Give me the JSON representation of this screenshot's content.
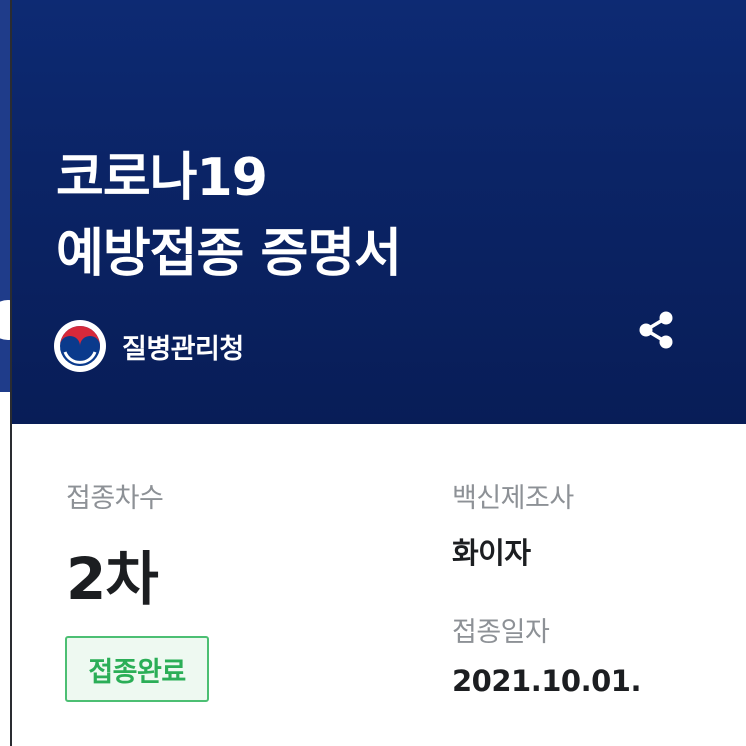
{
  "header": {
    "title_line1": "코로나19",
    "title_line2": "예방접종 증명서",
    "agency_name": "질병관리청",
    "share_icon": "share-icon",
    "agency_emblem": "taegeuk-emblem-icon"
  },
  "vaccination": {
    "dose_label": "접종차수",
    "dose_value": "2차",
    "status_badge": "접종완료",
    "manufacturer_label": "백신제조사",
    "manufacturer_value": "화이자",
    "date_label": "접종일자",
    "date_value": "2021.10.01."
  },
  "colors": {
    "header_bg": "#0b2466",
    "status_green": "#2bae57",
    "label_gray": "#8d9196"
  }
}
